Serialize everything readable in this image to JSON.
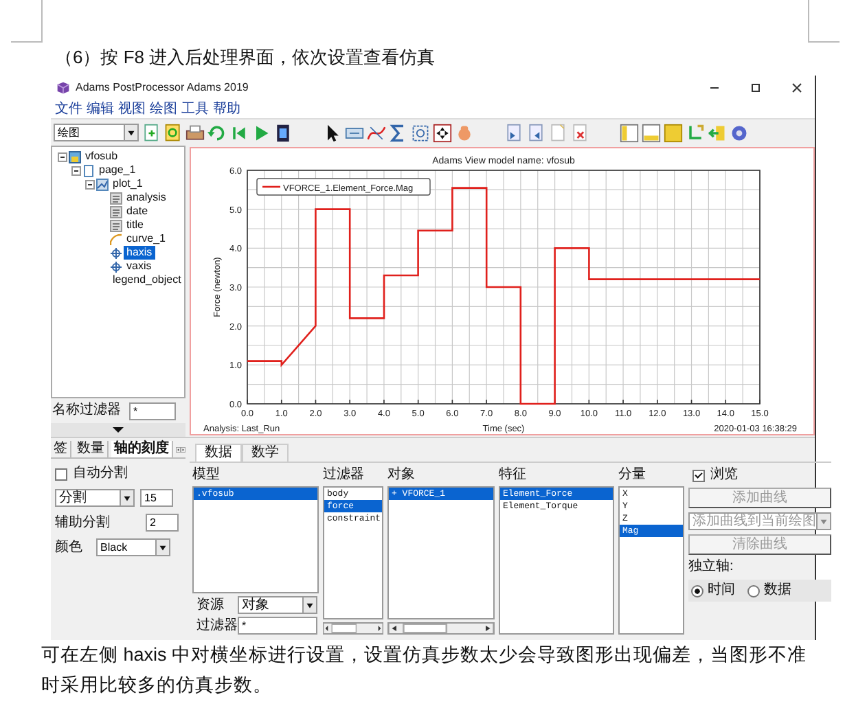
{
  "caption": "（6）按 F8 进入后处理界面，依次设置查看仿真",
  "window": {
    "title": "Adams PostProcessor Adams 2019"
  },
  "menu": [
    "文件",
    "编辑",
    "视图",
    "绘图",
    "工具",
    "帮助"
  ],
  "toolbar": {
    "mode_dropdown": "绘图"
  },
  "tree": [
    {
      "label": "vfosub",
      "kind": "model",
      "expanded": true,
      "selected": false,
      "children": [
        {
          "label": "page_1",
          "kind": "page",
          "expanded": true,
          "selected": false,
          "children": [
            {
              "label": "plot_1",
              "kind": "plot",
              "expanded": true,
              "selected": false,
              "children": [
                {
                  "label": "analysis",
                  "kind": "text",
                  "selected": false
                },
                {
                  "label": "date",
                  "kind": "text",
                  "selected": false
                },
                {
                  "label": "title",
                  "kind": "text",
                  "selected": false
                },
                {
                  "label": "curve_1",
                  "kind": "curve",
                  "selected": false
                },
                {
                  "label": "haxis",
                  "kind": "axis",
                  "selected": true
                },
                {
                  "label": "vaxis",
                  "kind": "axis",
                  "selected": false
                },
                {
                  "label": "legend_object",
                  "kind": "none",
                  "selected": false
                }
              ]
            }
          ]
        }
      ]
    }
  ],
  "name_filter": {
    "label": "名称过滤器",
    "value": "*"
  },
  "plot": {
    "analysis_label": "Analysis: Last_Run",
    "timestamp": "2020-01-03 16:38:29",
    "chart_data": {
      "type": "line",
      "title": "Adams View model name: vfosub",
      "xlabel": "Time (sec)",
      "ylabel": "Force (newton)",
      "x": [
        0,
        1,
        1,
        2,
        2,
        3,
        3,
        4,
        4,
        5,
        5,
        6,
        6,
        7,
        7,
        8,
        8,
        9,
        9,
        10,
        10,
        15
      ],
      "series": [
        {
          "name": "VFORCE_1.Element_Force.Mag",
          "color": "#e0201c",
          "values": [
            1.1,
            1.1,
            1.0,
            2.0,
            5.0,
            5.0,
            2.2,
            2.2,
            3.3,
            3.3,
            4.45,
            4.45,
            5.55,
            5.55,
            3.0,
            3.0,
            0,
            0,
            4.0,
            4.0,
            3.2,
            3.2
          ]
        }
      ],
      "xlim": [
        0,
        15
      ],
      "ylim": [
        0,
        6
      ],
      "grid": true,
      "xticks": [
        {
          "value": 0,
          "label": "0.0"
        },
        {
          "value": 1,
          "label": "1.0"
        },
        {
          "value": 2,
          "label": "2.0"
        },
        {
          "value": 3,
          "label": "3.0"
        },
        {
          "value": 4,
          "label": "4.0"
        },
        {
          "value": 5,
          "label": "5.0"
        },
        {
          "value": 6,
          "label": "6.0"
        },
        {
          "value": 7,
          "label": "7.0"
        },
        {
          "value": 8,
          "label": "8.0"
        },
        {
          "value": 9,
          "label": "9.0"
        },
        {
          "value": 10,
          "label": "10.0"
        },
        {
          "value": 11,
          "label": "11.0"
        },
        {
          "value": 12,
          "label": "12.0"
        },
        {
          "value": 13,
          "label": "13.0"
        },
        {
          "value": 14,
          "label": "14.0"
        },
        {
          "value": 15,
          "label": "15.0"
        }
      ],
      "yticks": [
        {
          "value": 0,
          "label": "0.0"
        },
        {
          "value": 1,
          "label": "1.0"
        },
        {
          "value": 2,
          "label": "2.0"
        },
        {
          "value": 3,
          "label": "3.0"
        },
        {
          "value": 4,
          "label": "4.0"
        },
        {
          "value": 5,
          "label": "5.0"
        },
        {
          "value": 6,
          "label": "6.0"
        }
      ]
    }
  },
  "axis_tabs": [
    {
      "label": "签",
      "selected": false
    },
    {
      "label": "数量",
      "selected": false
    },
    {
      "label": "轴的刻度",
      "selected": true
    }
  ],
  "axis_settings": {
    "auto_divide": {
      "label": "自动分割",
      "checked": false
    },
    "divisions": {
      "dropdown": "分割",
      "value": "15"
    },
    "minor": {
      "label": "辅助分割",
      "value": "2"
    },
    "color": {
      "label": "颜色",
      "value": "Black"
    }
  },
  "data_tabs": [
    {
      "label": "数据",
      "selected": true
    },
    {
      "label": "数学",
      "selected": false
    }
  ],
  "lists": [
    {
      "heading": "模型",
      "items": [
        {
          "text": ".vfosub",
          "selected": true
        }
      ]
    },
    {
      "heading": "过滤器",
      "items": [
        {
          "text": "body",
          "selected": false
        },
        {
          "text": "force",
          "selected": true
        },
        {
          "text": "constraint",
          "selected": false
        }
      ]
    },
    {
      "heading": "对象",
      "items": [
        {
          "text": "+ VFORCE_1",
          "selected": true
        }
      ]
    },
    {
      "heading": "特征",
      "items": [
        {
          "text": "Element_Force",
          "selected": true
        },
        {
          "text": "Element_Torque",
          "selected": false
        }
      ]
    },
    {
      "heading": "分量",
      "items": [
        {
          "text": "X",
          "selected": false
        },
        {
          "text": "Y",
          "selected": false
        },
        {
          "text": "Z",
          "selected": false
        },
        {
          "text": "Mag",
          "selected": true
        }
      ]
    }
  ],
  "source": {
    "label": "资源",
    "value": "对象"
  },
  "object_filter": {
    "label": "过滤器",
    "value": "*"
  },
  "browse": {
    "label": "浏览",
    "checked": true
  },
  "actions": [
    {
      "kind": "button",
      "label": "添加曲线",
      "disabled": true
    },
    {
      "kind": "dropdown",
      "label": "添加曲线到当前绘图",
      "disabled": true
    },
    {
      "kind": "button",
      "label": "清除曲线",
      "disabled": true
    }
  ],
  "independent_axis": {
    "label": "独立轴:",
    "options": [
      {
        "label": "时间",
        "selected": true
      },
      {
        "label": "数据",
        "selected": false
      }
    ]
  },
  "paragraph": "可在左侧 haxis 中对横坐标进行设置，设置仿真步数太少会导致图形出现偏差，当图形不准时采用比较多的仿真步数。"
}
